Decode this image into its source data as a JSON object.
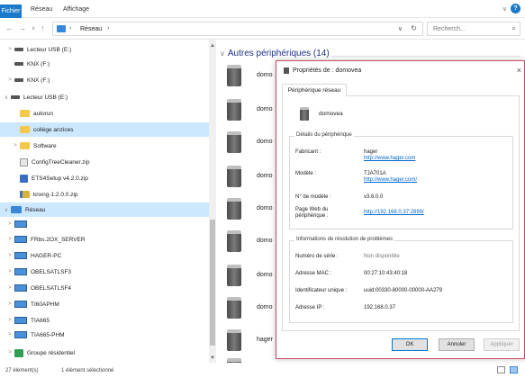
{
  "ribbon": {
    "tabs": [
      "Fichier",
      "Réseau",
      "Affichage"
    ]
  },
  "address": {
    "back": "←",
    "forward": "→",
    "up": "↑",
    "chevron": "›",
    "path": "Réseau",
    "dropdown": "∨",
    "refresh": "↻",
    "search_placeholder": "Recherch...",
    "search_icon": "⌕"
  },
  "navpane": {
    "items": [
      {
        "label": "Lecteur USB (E:)",
        "icon": "usb-drive-icon",
        "arrow": ">"
      },
      {
        "label": "KNX (F:)",
        "icon": "usb-drive-icon",
        "arrow": ""
      },
      {
        "label": "KNX (F:)",
        "icon": "usb-drive-icon",
        "arrow": ">"
      },
      {
        "label": "Lecteur USB (E:)",
        "icon": "usb-drive-icon",
        "arrow": "∨"
      },
      {
        "label": "autorun",
        "icon": "folder-icon",
        "arrow": ""
      },
      {
        "label": "collège anzices",
        "icon": "folder-icon",
        "arrow": "",
        "selected": true
      },
      {
        "label": "Software",
        "icon": "folder-icon",
        "arrow": ">"
      },
      {
        "label": "ConfigTreeCleaner.zip",
        "icon": "zip-icon",
        "arrow": ""
      },
      {
        "label": "ETS4Setup v4.2.0.zip",
        "icon": "exe-icon",
        "arrow": ""
      },
      {
        "label": "knxng-1.2.0.0.zip",
        "icon": "zip-icon",
        "arrow": ""
      },
      {
        "label": "Réseau",
        "icon": "network-icon",
        "arrow": "∨",
        "selected": true
      },
      {
        "label": "",
        "icon": "computer-icon",
        "arrow": ">"
      },
      {
        "label": "FRbs.2OX_SERVER",
        "icon": "computer-icon",
        "arrow": ">"
      },
      {
        "label": "HAGER-PC",
        "icon": "computer-icon",
        "arrow": ">"
      },
      {
        "label": "OBELSATLSF3",
        "icon": "computer-icon",
        "arrow": ">"
      },
      {
        "label": "OBELSATLSF4",
        "icon": "computer-icon",
        "arrow": ">"
      },
      {
        "label": "TI60APHM",
        "icon": "computer-icon",
        "arrow": ">"
      },
      {
        "label": "TIA665",
        "icon": "computer-icon",
        "arrow": ">"
      },
      {
        "label": "TIA665-PHM",
        "icon": "computer-icon",
        "arrow": ">"
      },
      {
        "label": "TIA665-",
        "icon": "computer-icon",
        "arrow": ">"
      },
      {
        "label": "Groupe résidentiel",
        "icon": "homegroup-icon",
        "arrow": ">"
      }
    ]
  },
  "content": {
    "group_title": "Autres périphériques (14)",
    "devices": [
      "domo",
      "domo",
      "domo",
      "domo",
      "domo",
      "domo",
      "domo",
      "domo",
      "hager",
      ""
    ]
  },
  "status": {
    "count": "27 élément(s)",
    "selection": "1 élément sélectionné"
  },
  "dialog": {
    "title": "Propriétés de : domovea",
    "close": "×",
    "tab": "Périphérique réseau",
    "device_name": "domovea",
    "details_legend": "Détails du périphérique",
    "manufacturer_label": "Fabricant :",
    "manufacturer_value": "hager",
    "manufacturer_link": "http://www.hager.com",
    "model_label": "Modèle :",
    "model_value": "TJA701A",
    "model_link": "http://www.hager.com/",
    "model_number_label": "N° de modèle :",
    "model_number_value": "v3.6.0.0",
    "web_page_label_1": "Page Web du",
    "web_page_label_2": "périphérique :",
    "web_page_link": "http://192.168.0.37:2899/",
    "troubleshoot_legend": "Informations de résolution de problèmes",
    "serial_label": "Numéro de série :",
    "serial_value": "Non disponible",
    "mac_label": "Adresse MAC :",
    "mac_value": "00:27:10:43:40:18",
    "uid_label": "Identificateur unique :",
    "uid_value": "uuid:00330-80000-00000-AA279",
    "ip_label": "Adresse IP :",
    "ip_value": "192.168.0.37",
    "ok": "OK",
    "cancel": "Annuler",
    "apply": "Appliquer"
  }
}
